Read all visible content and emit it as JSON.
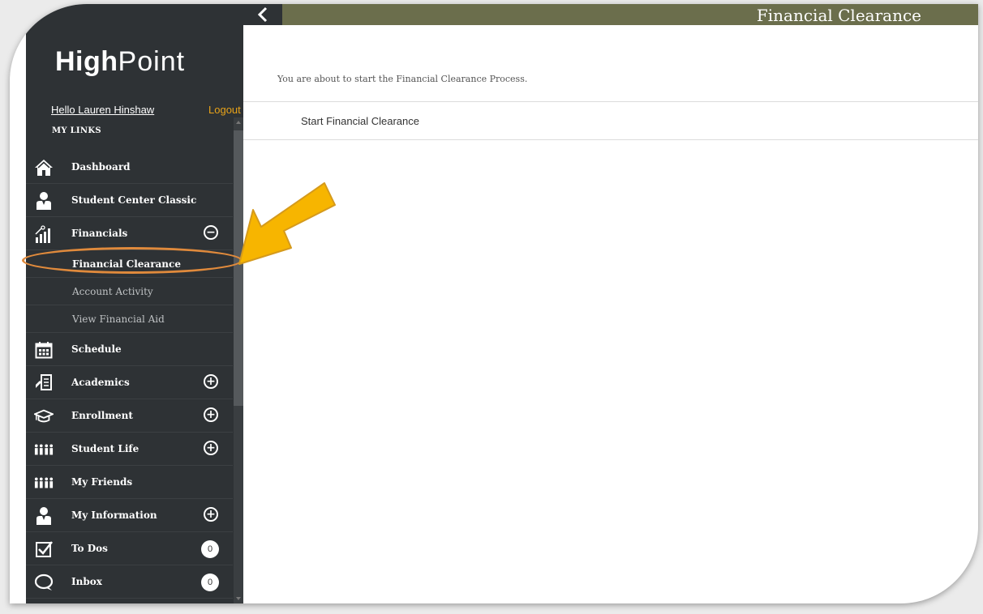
{
  "app": {
    "logo_bold": "High",
    "logo_light": "Point"
  },
  "user": {
    "greeting": "Hello Lauren Hinshaw",
    "logout_label": "Logout"
  },
  "sidebar": {
    "section_label": "MY LINKS",
    "items": [
      {
        "label": "Dashboard",
        "icon": "house-icon"
      },
      {
        "label": "Student Center Classic",
        "icon": "person-icon"
      },
      {
        "label": "Financials",
        "icon": "chart-icon",
        "toggle": "−"
      },
      {
        "label": "Schedule",
        "icon": "calendar-icon"
      },
      {
        "label": "Academics",
        "icon": "document-icon",
        "toggle": "+"
      },
      {
        "label": "Enrollment",
        "icon": "graduation-cap-icon",
        "toggle": "+"
      },
      {
        "label": "Student Life",
        "icon": "group-icon",
        "toggle": "+"
      },
      {
        "label": "My Friends",
        "icon": "group-icon"
      },
      {
        "label": "My Information",
        "icon": "person-icon",
        "toggle": "+"
      },
      {
        "label": "To Dos",
        "icon": "checkbox-icon",
        "badge": "0"
      },
      {
        "label": "Inbox",
        "icon": "chat-icon",
        "badge": "0"
      }
    ],
    "financials_sub": [
      {
        "label": "Financial Clearance",
        "active": true
      },
      {
        "label": "Account Activity"
      },
      {
        "label": "View Financial Aid"
      }
    ]
  },
  "header": {
    "title": "Financial Clearance"
  },
  "main": {
    "intro_text": "You are about to start the Financial Clearance Process.",
    "start_link": "Start Financial Clearance"
  },
  "colors": {
    "sidebar_bg": "#2e3235",
    "header_bg": "#6b6e4c",
    "accent_logout": "#e8a319",
    "annotation_arrow": "#f7b500",
    "annotation_oval": "#e08a3c"
  }
}
